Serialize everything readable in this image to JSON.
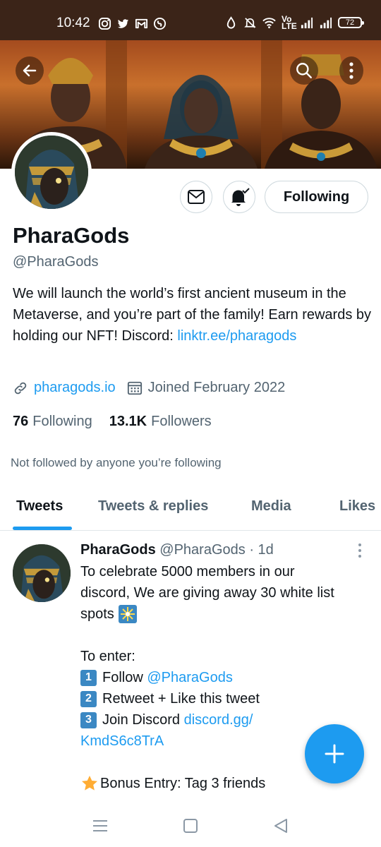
{
  "status_bar": {
    "time": "10:42",
    "volte_label": "Vo LTE",
    "battery": "72",
    "left_icons": [
      "instagram-icon",
      "twitter-icon",
      "gmail-icon",
      "shazam-icon"
    ],
    "right_icons": [
      "data-saver-icon",
      "bell-off-icon",
      "wifi-icon",
      "signal-icon",
      "signal-icon"
    ]
  },
  "profile": {
    "display_name": "PharaGods",
    "handle": "@PharaGods",
    "bio_text": "We will launch the world’s first ancient museum in the Metaverse, and you’re part of the family! Earn rewards by holding our NFT! Discord: ",
    "bio_link": "linktr.ee/pharagods",
    "website": "pharagods.io",
    "joined": "Joined February 2022",
    "following_count": "76",
    "following_label": "Following",
    "followers_count": "13.1K",
    "followers_label": "Followers",
    "not_followed": "Not followed by anyone you’re following",
    "following_button": "Following"
  },
  "tabs": [
    {
      "label": "Tweets",
      "active": true
    },
    {
      "label": "Tweets & replies",
      "active": false
    },
    {
      "label": "Media",
      "active": false
    },
    {
      "label": "Likes",
      "active": false
    }
  ],
  "tweet": {
    "name": "PharaGods",
    "handle": "@PharaGods",
    "age": "· 1d",
    "line1": "To celebrate 5000 members in our",
    "line2": "discord, We are giving away 30 white list",
    "line3": "spots",
    "enter": "To enter:",
    "step1_key": "1",
    "step1_text": "Follow ",
    "step1_link": "@PharaGods",
    "step2_key": "2",
    "step2_text": "Retweet + Like this tweet",
    "step3_key": "3",
    "step3_text": "Join Discord ",
    "step3_link_a": "discord.gg/",
    "step3_link_b": "KmdS6c8TrA",
    "bonus": "Bonus Entry: Tag 3 friends"
  },
  "colors": {
    "accent": "#1d9bf0",
    "secondary_text": "#536471",
    "primary_text": "#0f1419",
    "status_bar": "#3b2418"
  }
}
